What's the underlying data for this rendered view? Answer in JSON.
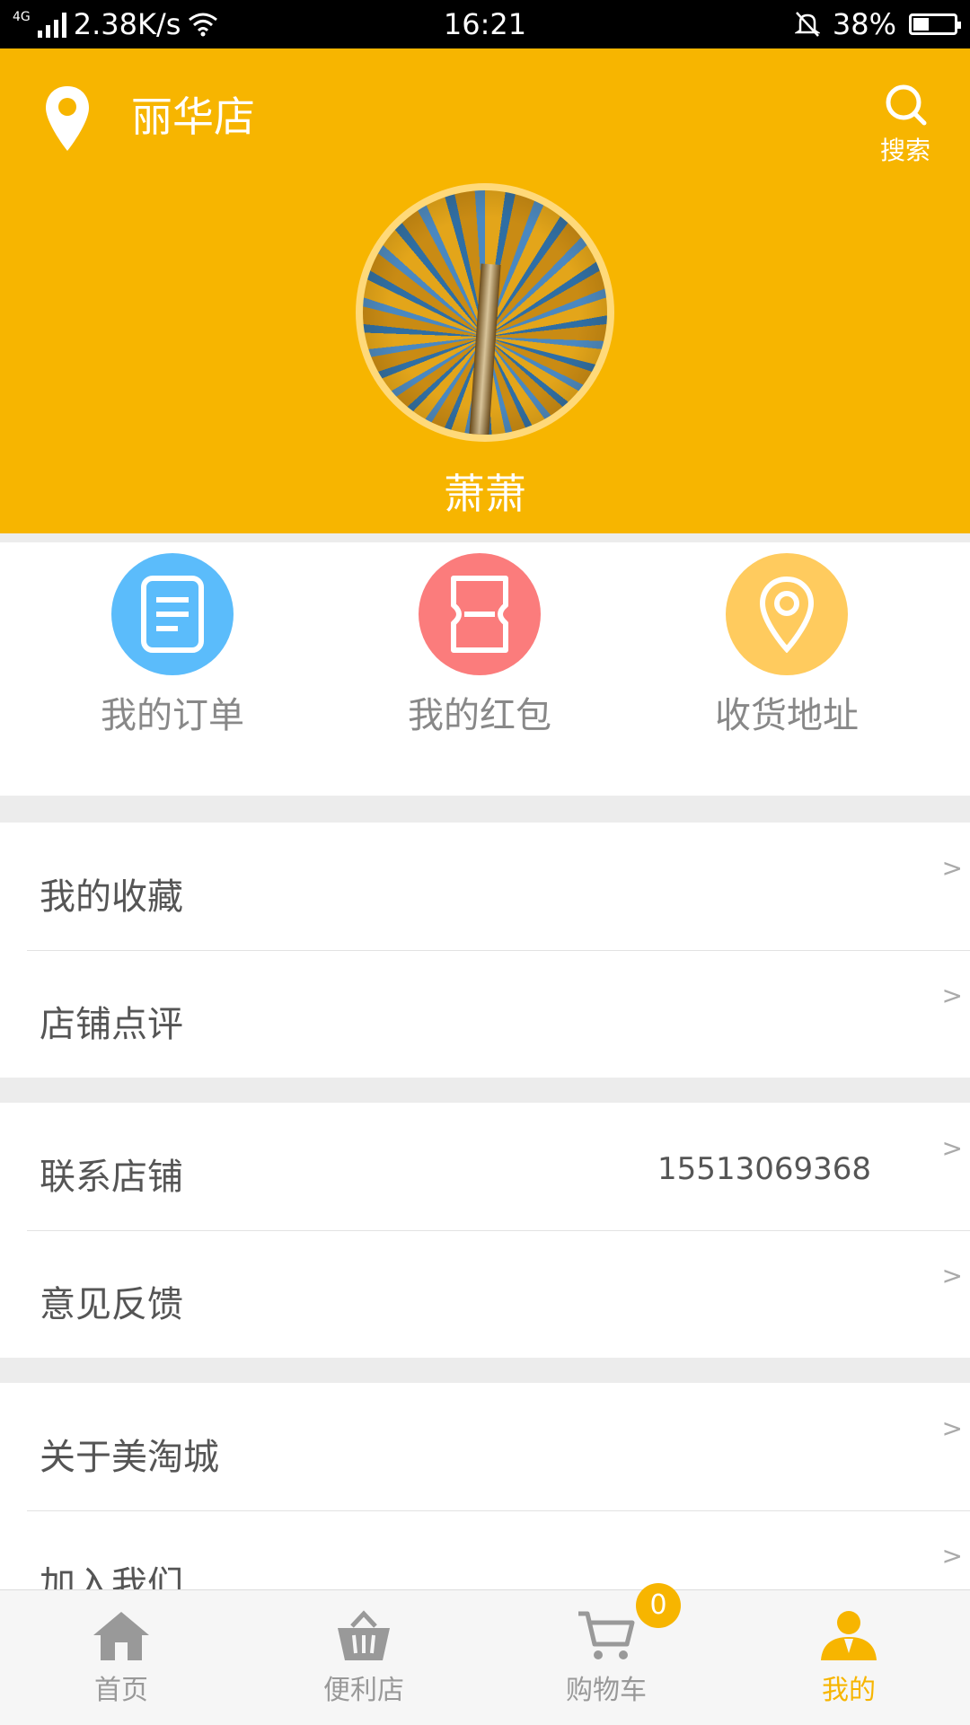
{
  "status_bar": {
    "network": "4G",
    "speed": "2.38K/s",
    "time": "16:21",
    "battery": "38%",
    "battery_level": 0.38
  },
  "header": {
    "store_name": "丽华店",
    "search_label": "搜索",
    "username": "萧萧",
    "background_color": "#f7b500"
  },
  "quick_actions": [
    {
      "label": "我的订单",
      "icon": "order-icon",
      "color": "#5bbcfb"
    },
    {
      "label": "我的红包",
      "icon": "ticket-icon",
      "color": "#fb7c7c"
    },
    {
      "label": "收货地址",
      "icon": "location-icon",
      "color": "#ffcb5e"
    }
  ],
  "menu_groups": [
    {
      "items": [
        {
          "label": "我的收藏"
        },
        {
          "label": "店铺点评"
        }
      ]
    },
    {
      "items": [
        {
          "label": "联系店铺",
          "value": "15513069368"
        },
        {
          "label": "意见反馈"
        }
      ]
    },
    {
      "items": [
        {
          "label": "关于美淘城"
        },
        {
          "label": "加入我们"
        }
      ]
    }
  ],
  "tab_bar": {
    "tabs": [
      {
        "label": "首页",
        "icon": "home-icon"
      },
      {
        "label": "便利店",
        "icon": "basket-icon"
      },
      {
        "label": "购物车",
        "icon": "cart-icon"
      },
      {
        "label": "我的",
        "icon": "user-icon",
        "active": true
      }
    ],
    "cart_badge": "0",
    "active_color": "#f7b500"
  }
}
